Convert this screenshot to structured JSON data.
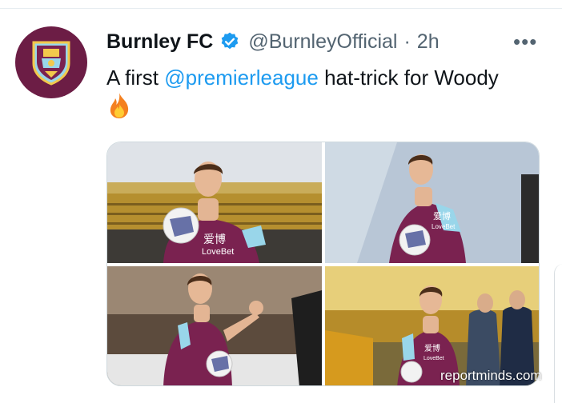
{
  "tweet": {
    "display_name": "Burnley FC",
    "handle": "@BurnleyOfficial",
    "separator": "·",
    "time": "2h",
    "more_label": "•••",
    "text_before": "A first ",
    "mention": "@premierleague",
    "text_after": " hat-trick for Woody",
    "emoji": "fire-emoji-icon",
    "avatar": "burnley-crest-icon",
    "verified": "verified-badge-icon"
  },
  "media": {
    "photos": [
      {
        "sponsor_text": "爱博",
        "sponsor_brand": "LoveBet"
      },
      {
        "sponsor_text": "爱博",
        "sponsor_brand": "LoveBet"
      },
      {
        "sponsor_text": "",
        "sponsor_brand": ""
      },
      {
        "sponsor_text": "爱博",
        "sponsor_brand": "LoveBet"
      }
    ],
    "watermark": "reportminds.com"
  },
  "colors": {
    "brand_claret": "#6c1d45",
    "sky_blue": "#99d6ea",
    "link_blue": "#1d9bf0",
    "verified_blue": "#1d9bf0",
    "secondary_text": "#536471"
  }
}
